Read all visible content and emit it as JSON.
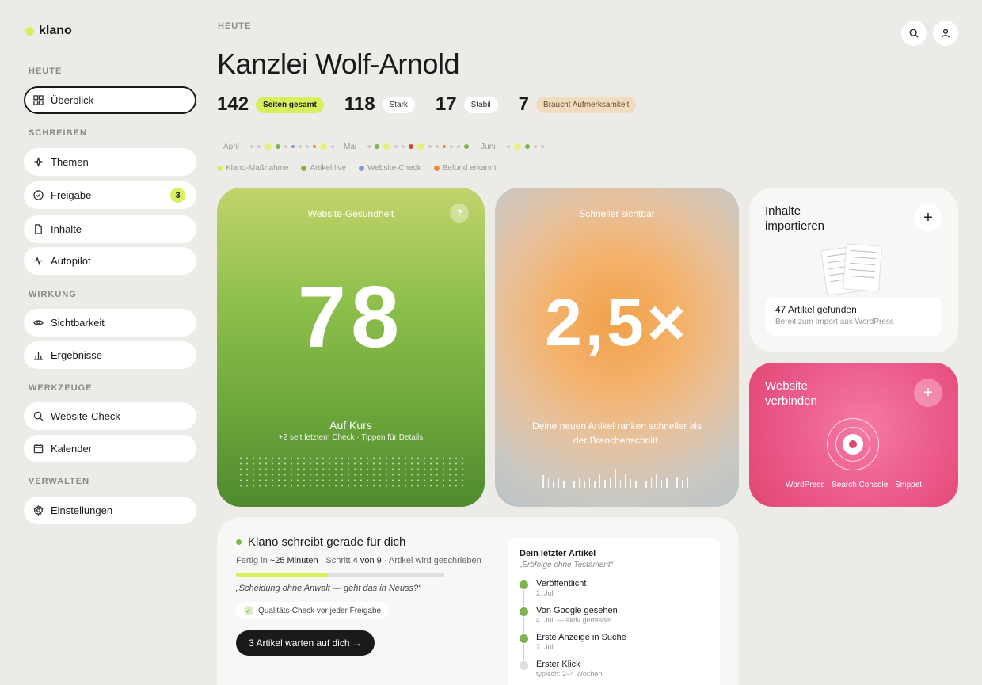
{
  "brand": {
    "name": "klano",
    "dot_color": "#d9ef5e"
  },
  "sidebar": {
    "sections": [
      {
        "label": "HEUTE",
        "items": [
          {
            "label": "Überblick",
            "icon": "grid-icon",
            "active": true
          }
        ]
      },
      {
        "label": "SCHREIBEN",
        "items": [
          {
            "label": "Themen",
            "icon": "sparkle-icon"
          },
          {
            "label": "Freigabe",
            "icon": "check-circle-icon",
            "badge": "3"
          },
          {
            "label": "Inhalte",
            "icon": "document-icon"
          },
          {
            "label": "Autopilot",
            "icon": "pulse-icon"
          }
        ]
      },
      {
        "label": "WIRKUNG",
        "items": [
          {
            "label": "Sichtbarkeit",
            "icon": "eye-icon"
          },
          {
            "label": "Ergebnisse",
            "icon": "bar-chart-icon"
          }
        ]
      },
      {
        "label": "WERKZEUGE",
        "items": [
          {
            "label": "Website-Check",
            "icon": "search-icon"
          },
          {
            "label": "Kalender",
            "icon": "calendar-icon"
          }
        ]
      },
      {
        "label": "VERWALTEN",
        "items": [
          {
            "label": "Einstellungen",
            "icon": "gear-icon"
          }
        ]
      }
    ]
  },
  "header": {
    "kicker": "HEUTE",
    "title": "Kanzlei Wolf-Arnold",
    "actions": [
      "search-icon",
      "user-icon"
    ]
  },
  "stats": [
    {
      "value": "142",
      "label": "Seiten gesamt",
      "color": "#d9ef5e"
    },
    {
      "value": "118",
      "label": "Stark",
      "color": "#ffffff"
    },
    {
      "value": "17",
      "label": "Stabil",
      "color": "#ffffff"
    },
    {
      "value": "7",
      "label": "Braucht Aufmerksamkeit",
      "color": "#f1dcc0"
    }
  ],
  "timeline": {
    "months": [
      "April",
      "Mai",
      "Juni"
    ]
  },
  "legend": [
    {
      "label": "Klano-Maßnahme",
      "color": "#d9ef5e"
    },
    {
      "label": "Artikel live",
      "color": "#7fb34d"
    },
    {
      "label": "Website-Check",
      "color": "#7b9fd4"
    },
    {
      "label": "Befund erkannt",
      "color": "#e98a3d"
    }
  ],
  "health": {
    "title": "Website-Gesundheit",
    "help": "?",
    "score": "78",
    "status": "Auf Kurs",
    "sub": "+2 seit letztem Check · Tippen für Details"
  },
  "speed": {
    "title": "Schneller sichtbar",
    "value": "2,5×",
    "desc": "Deine neuen Artikel ranken schneller als der Branchenschnitt."
  },
  "import": {
    "title_line1": "Inhalte",
    "title_line2": "importieren",
    "plus": "+",
    "found": "47 Artikel gefunden",
    "found_sub": "Bereit zum Import aus WordPress"
  },
  "connect": {
    "title_line1": "Website",
    "title_line2": "verbinden",
    "plus": "+",
    "footer": "WordPress · Search Console · Snippet"
  },
  "writing": {
    "title": "Klano schreibt gerade für dich",
    "meta_prefix": "Fertig in ",
    "meta_time": "~25 Minuten",
    "meta_mid": " · Schritt ",
    "meta_step": "4 von 9",
    "meta_suffix": " · Artikel wird geschrieben",
    "progress": 0.44,
    "quote": "„Scheidung ohne Anwalt — geht das in Neuss?“",
    "chip": "Qualitäts-Check vor jeder Freigabe",
    "button": "3 Artikel warten auf dich →"
  },
  "last_article": {
    "heading": "Dein letzter Artikel",
    "title": "„Erbfolge ohne Testament“",
    "steps": [
      {
        "label": "Veröffentlicht",
        "date": "2. Juli",
        "done": true
      },
      {
        "label": "Von Google gesehen",
        "date": "4. Juli — aktiv gemeldet",
        "done": true
      },
      {
        "label": "Erste Anzeige in Suche",
        "date": "7. Juli",
        "done": true
      },
      {
        "label": "Erster Klick",
        "date": "typisch: 2–4 Wochen",
        "done": false
      }
    ]
  }
}
